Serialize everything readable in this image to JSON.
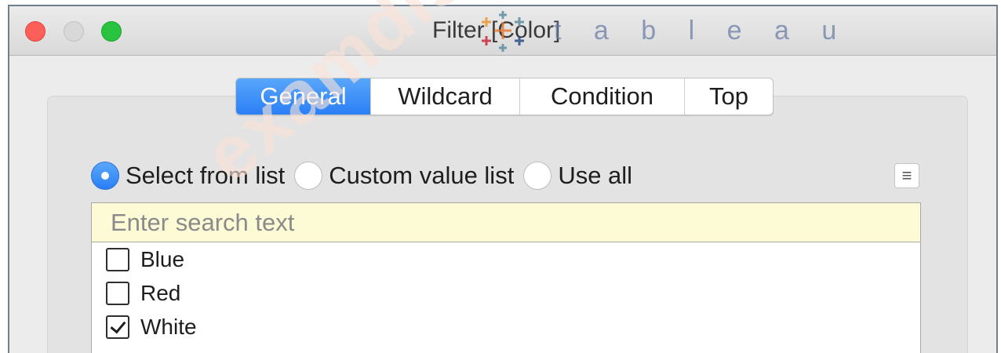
{
  "window": {
    "title": "Filter [Color]",
    "controls": [
      "close",
      "minimize",
      "zoom"
    ]
  },
  "logo": {
    "wordmark": "t a b l e a u",
    "colors": [
      "#e8762b",
      "#5b879b",
      "#c72037",
      "#1f457e",
      "#59879b",
      "#eb912b"
    ]
  },
  "tabs": [
    {
      "label": "General",
      "active": true
    },
    {
      "label": "Wildcard",
      "active": false
    },
    {
      "label": "Condition",
      "active": false
    },
    {
      "label": "Top",
      "active": false
    }
  ],
  "selection_mode": {
    "options": [
      {
        "label": "Select from list",
        "checked": true
      },
      {
        "label": "Custom value list",
        "checked": false
      },
      {
        "label": "Use all",
        "checked": false
      }
    ]
  },
  "menu_icon": "hamburger-menu-icon",
  "search": {
    "placeholder": "Enter search text",
    "value": ""
  },
  "values": [
    {
      "label": "Blue",
      "checked": false
    },
    {
      "label": "Red",
      "checked": false
    },
    {
      "label": "White",
      "checked": true
    }
  ],
  "watermark": "examdiscuss.com",
  "colors": {
    "accent": "#2b7ff5",
    "search_background": "#fdfbd6",
    "panel": "#e3e3e3"
  }
}
